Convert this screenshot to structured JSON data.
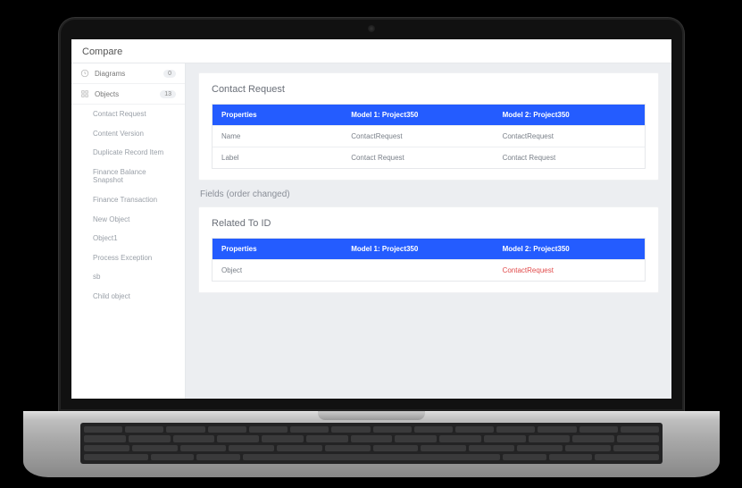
{
  "app_header": "Compare",
  "sidebar": {
    "sections": [
      {
        "icon": "clock-icon",
        "label": "Diagrams",
        "count": "0"
      },
      {
        "icon": "grid-icon",
        "label": "Objects",
        "count": "13"
      }
    ],
    "items": [
      "Contact Request",
      "Content Version",
      "Duplicate Record Item",
      "Finance Balance Snapshot",
      "Finance Transaction",
      "New Object",
      "Object1",
      "Process Exception",
      "sb",
      "Child object"
    ]
  },
  "panel1": {
    "title": "Contact Request",
    "columns": {
      "prop": "Properties",
      "m1": "Model 1: Project350",
      "m2": "Model 2: Project350"
    },
    "rows": [
      {
        "prop": "Name",
        "m1": "ContactRequest",
        "m2": "ContactRequest"
      },
      {
        "prop": "Label",
        "m1": "Contact Request",
        "m2": "Contact Request"
      }
    ]
  },
  "fields_label": "Fields (order changed)",
  "panel2": {
    "title": "Related To ID",
    "columns": {
      "prop": "Properties",
      "m1": "Model 1: Project350",
      "m2": "Model 2: Project350"
    },
    "rows": [
      {
        "prop": "Object",
        "m1": "",
        "m2": "ContactRequest",
        "m2_red": true
      }
    ]
  }
}
